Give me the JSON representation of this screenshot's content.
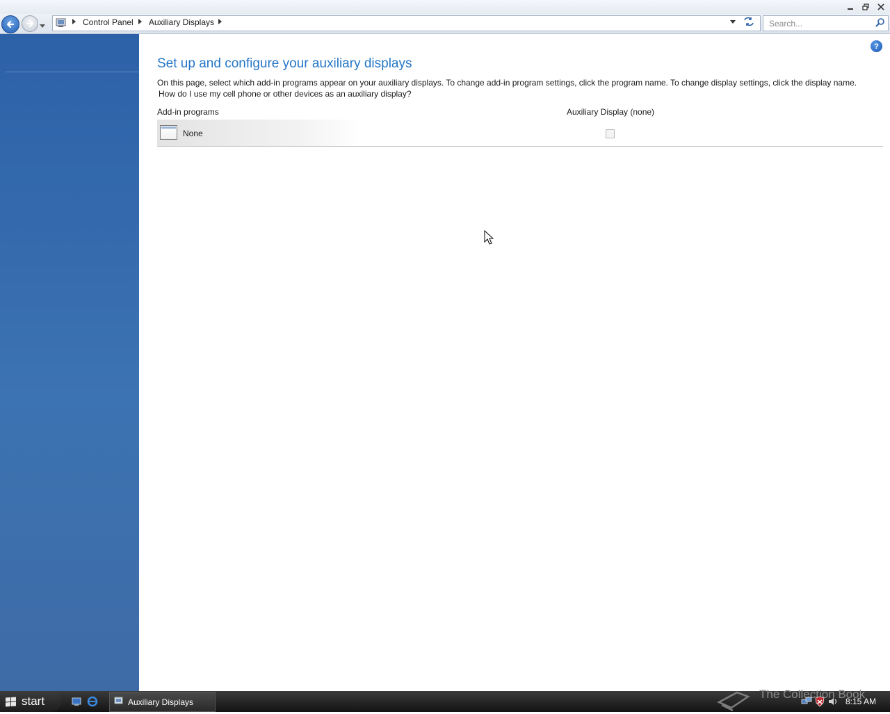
{
  "window": {
    "controls": [
      "minimize",
      "maximize",
      "close"
    ]
  },
  "nav": {
    "breadcrumbs": [
      "Control Panel",
      "Auxiliary Displays"
    ],
    "search_placeholder": "Search..."
  },
  "main": {
    "title": "Set up and configure your auxiliary displays",
    "description": "On this page, select which add-in programs appear on your auxiliary displays. To change add-in program settings, click the program name. To change display settings, click the display name.",
    "help_link": "How do I use my cell phone or other devices as an auxiliary display?",
    "columns": {
      "programs": "Add-in programs",
      "display": "Auxiliary Display (none)"
    },
    "rows": [
      {
        "name": "None",
        "checked": false
      }
    ]
  },
  "taskbar": {
    "start_label": "start",
    "task_label": "Auxiliary Displays",
    "watermark": "The Collection Book",
    "clock": "8:15 AM"
  },
  "colors": {
    "title_blue": "#2577c7",
    "left_pane": "#3c73b2"
  }
}
